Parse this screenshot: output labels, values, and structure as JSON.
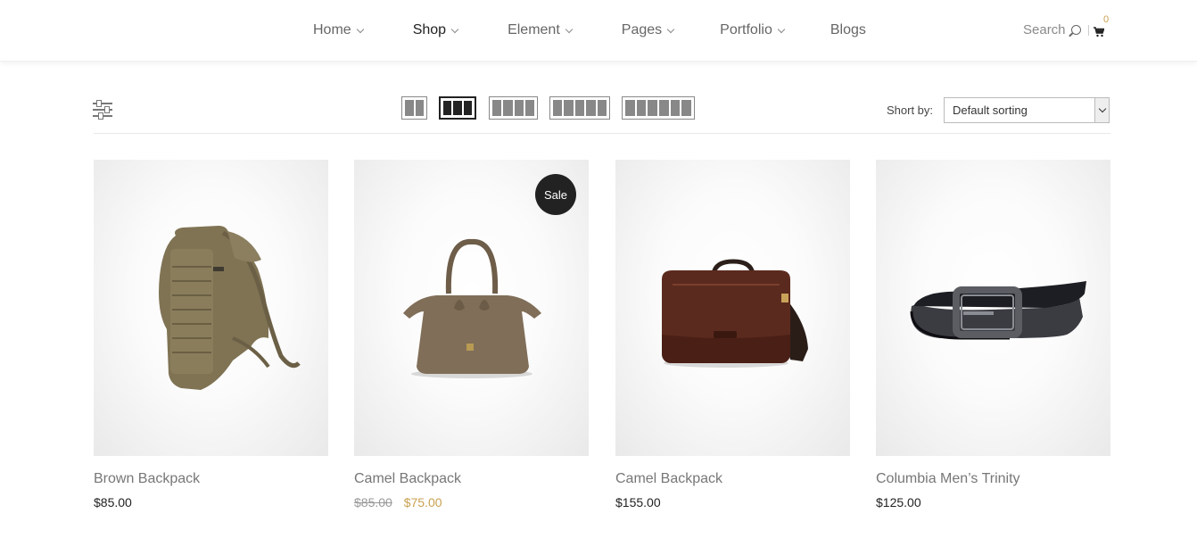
{
  "nav": {
    "items": [
      {
        "label": "Home",
        "has_dropdown": true,
        "active": false
      },
      {
        "label": "Shop",
        "has_dropdown": true,
        "active": true
      },
      {
        "label": "Element",
        "has_dropdown": true,
        "active": false
      },
      {
        "label": "Pages",
        "has_dropdown": true,
        "active": false
      },
      {
        "label": "Portfolio",
        "has_dropdown": true,
        "active": false
      },
      {
        "label": "Blogs",
        "has_dropdown": false,
        "active": false
      }
    ],
    "search_label": "Search",
    "cart_count": "0"
  },
  "toolbar": {
    "filter_icon": "sliders-icon",
    "grid_options": [
      {
        "columns": 2,
        "active": false
      },
      {
        "columns": 3,
        "active": true
      },
      {
        "columns": 4,
        "active": false
      },
      {
        "columns": 5,
        "active": false
      },
      {
        "columns": 6,
        "active": false
      }
    ],
    "sort_label": "Short by:",
    "sort_value": "Default sorting"
  },
  "products": [
    {
      "name": "Brown Backpack",
      "price": "$85.00",
      "sale": false,
      "image": "tactical-backpack"
    },
    {
      "name": "Camel Backpack",
      "old_price": "$85.00",
      "price": "$75.00",
      "sale": true,
      "badge": "Sale",
      "image": "camel-handbag"
    },
    {
      "name": "Camel Backpack",
      "price": "$155.00",
      "sale": false,
      "image": "leather-messenger-bag"
    },
    {
      "name": "Columbia Men’s Trinity",
      "price": "$125.00",
      "sale": false,
      "image": "leather-belt"
    }
  ],
  "colors": {
    "accent": "#c9a050",
    "badge_bg": "#222222",
    "text_muted": "#777777"
  }
}
